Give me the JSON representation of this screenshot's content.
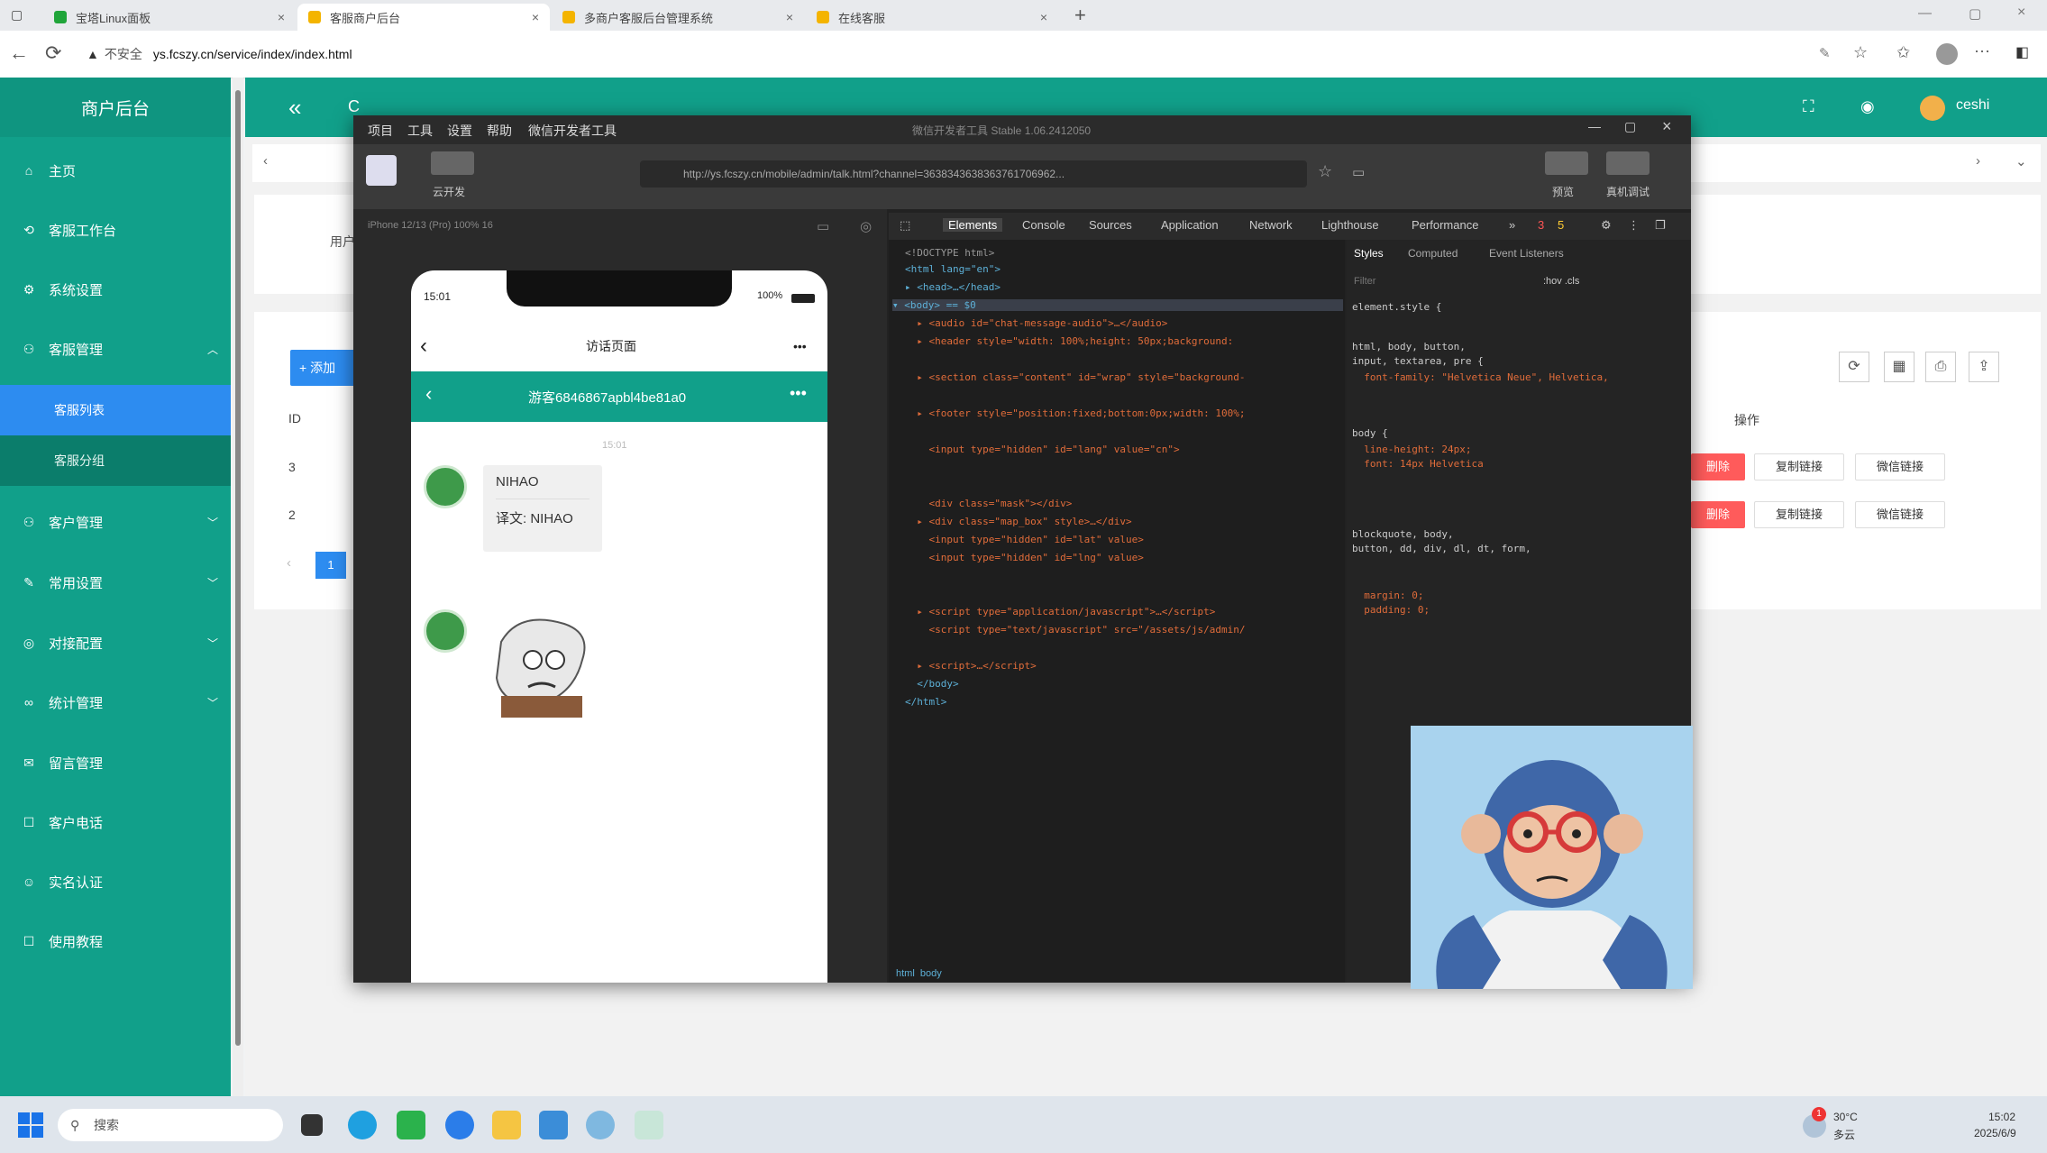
{
  "browser": {
    "tabs": [
      {
        "label": "宝塔Linux面板",
        "active": false,
        "color": "#20a53a"
      },
      {
        "label": "客服商户后台",
        "active": true,
        "color": "#f4b400"
      },
      {
        "label": "多商户客服后台管理系统",
        "active": false,
        "color": "#f4b400"
      },
      {
        "label": "在线客服",
        "active": false,
        "color": "#f4b400"
      }
    ],
    "new_tab": "+",
    "security_label": "不安全",
    "url": "ys.fcszy.cn/service/index/index.html"
  },
  "sidebar": {
    "title": "商户后台",
    "items": [
      {
        "label": "主页",
        "icon": "home-icon",
        "glyph": "⌂"
      },
      {
        "label": "客服工作台",
        "icon": "workbench-icon",
        "glyph": "⟲"
      },
      {
        "label": "系统设置",
        "icon": "gear-icon",
        "glyph": "⚙"
      },
      {
        "label": "客服管理",
        "icon": "user-icon",
        "glyph": "⚇"
      },
      {
        "label": "客户管理",
        "icon": "customer-icon",
        "glyph": "⚇"
      },
      {
        "label": "常用设置",
        "icon": "settings-icon",
        "glyph": "✎"
      },
      {
        "label": "对接配置",
        "icon": "plug-icon",
        "glyph": "◎"
      },
      {
        "label": "统计管理",
        "icon": "stats-icon",
        "glyph": "∞"
      },
      {
        "label": "留言管理",
        "icon": "message-icon",
        "glyph": "✉"
      },
      {
        "label": "客户电话",
        "icon": "phone-icon",
        "glyph": "☐"
      },
      {
        "label": "实名认证",
        "icon": "verify-icon",
        "glyph": "☺"
      },
      {
        "label": "使用教程",
        "icon": "book-icon",
        "glyph": "☐"
      }
    ],
    "sub_items": [
      {
        "label": "客服列表",
        "active": true
      },
      {
        "label": "客服分组",
        "active": false
      }
    ]
  },
  "header": {
    "collapse": "«",
    "refresh": "C",
    "user": "ceshi"
  },
  "content": {
    "breadcrumb": "用户",
    "add_button": "+ 添加",
    "col_id": "ID",
    "col_ops": "操作",
    "rows": [
      {
        "id": "3",
        "delete": "删除",
        "copy": "复制链接",
        "wechat": "微信链接"
      },
      {
        "id": "2",
        "delete": "删除",
        "copy": "复制链接",
        "wechat": "微信链接"
      }
    ],
    "page": "1"
  },
  "devtools": {
    "menu": [
      "项目",
      "工具",
      "设置",
      "帮助",
      "微信开发者工具"
    ],
    "title": "微信开发者工具 Stable 1.06.2412050",
    "cloud": "云开发",
    "preview": "预览",
    "real_debug": "真机调试",
    "url": "http://ys.fcszy.cn/mobile/admin/talk.html?channel=3638343638363761706962...",
    "device": "iPhone 12/13 (Pro) 100% 16",
    "tabs": [
      "Elements",
      "Console",
      "Sources",
      "Application",
      "Network",
      "Lighthouse",
      "Performance"
    ],
    "style_tabs": [
      "Styles",
      "Computed",
      "Event Listeners"
    ],
    "filter": "Filter",
    "hov": ":hov .cls",
    "errors": "3",
    "warnings": "5",
    "breadcrumb": [
      "html",
      "body"
    ]
  },
  "phone": {
    "time": "15:01",
    "battery": "100%",
    "page_title": "访话页面",
    "chat_title": "游客6846867apbl4be81a0",
    "timestamp": "15:01",
    "message": "NIHAO",
    "translation": "译文: NIHAO"
  },
  "taskbar": {
    "search": "搜索",
    "weather_temp": "30°C",
    "weather_desc": "多云",
    "clock_time": "15:02",
    "clock_date": "2025/6/9",
    "badge": "1"
  }
}
